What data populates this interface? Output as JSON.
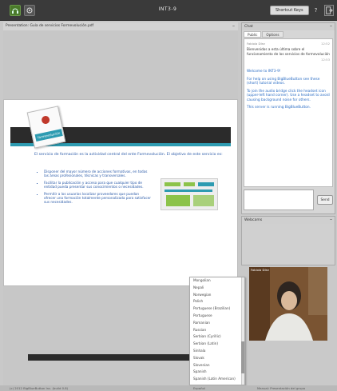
{
  "topbar": {
    "title": "INT3-9",
    "shortcut_keys_label": "Shortcut Keys",
    "help_label": "?"
  },
  "presentation": {
    "header_label": "Presentation: Guía de servicios Formevolución.pdf",
    "minimize_label": "–",
    "slide": {
      "logo_text": "formevolución",
      "intro": "El servicio de formación es la actividad central del ente Formevolución. El objetivo de este servicio es:",
      "bullets": [
        "Disponer del mayor número de acciones formativas, en todas las áreas profesionales, técnicas y transversales.",
        "Facilitar la publicación y acceso para que cualquier tipo de entidad pueda presentar sus conocimientos o necesidades.",
        "Permitir a los usuarios localizar proveedores que puedan ofrecer una formación totalmente personalizada para satisfacer sus necesidades."
      ]
    }
  },
  "chat": {
    "header_label": "Chat",
    "minimize_label": "–",
    "tabs": [
      {
        "label": "Public"
      },
      {
        "label": "Options"
      }
    ],
    "message": {
      "sender": "Fabiola Díez",
      "time": "12:52",
      "text": "Bienvenidos a esta última sobre el funcionamiento de los servicios de formevolución",
      "time2": "12:53"
    },
    "welcome_lines": [
      "Welcome to INT3-9!",
      "For help on using BigBlueButton see these (short) tutorial videos.",
      "To join the audio bridge click the headset icon (upper-left hand corner). Use a headset to avoid causing background noise for others.",
      "This server is running BigBlueButton."
    ],
    "send_label": "Send"
  },
  "webcams": {
    "header_label": "Webcams",
    "minimize_label": "–"
  },
  "video": {
    "label": "Fabiola Díez"
  },
  "language_dropdown": {
    "options": [
      "Mongolian",
      "Nepali",
      "Norwegian",
      "Polish",
      "Portuguese (Brazilian)",
      "Portuguese",
      "Romanian",
      "Russian",
      "Serbian (Cyrillic)",
      "Serbian (Latin)",
      "Sinhala",
      "Slovak",
      "Slovenian",
      "Spanish",
      "Spanish (Latin American)"
    ]
  },
  "bottombar": {
    "left_text": "(c) 2012 BigBlueButton Inc. (build 0.8)",
    "language_value": "Español",
    "right_text": "Manual: Presentación del grupo"
  },
  "colors": {
    "accent_teal": "#2d9bb1",
    "link_blue": "#2a6cc4",
    "topbar_bg": "#3a3a3a"
  }
}
